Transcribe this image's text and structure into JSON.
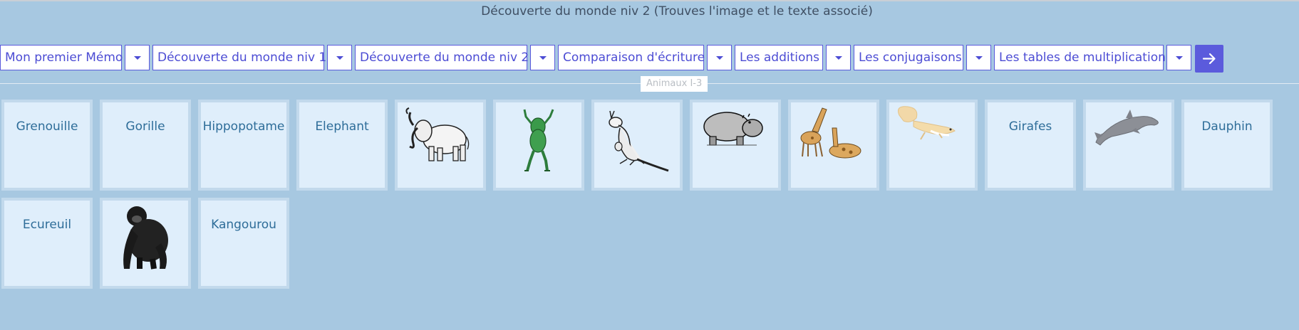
{
  "page": {
    "title": "Découverte du monde niv 2 (Trouves l'image et le texte associé)"
  },
  "toolbar": {
    "items": [
      {
        "label": "Mon premier Mémo"
      },
      {
        "label": "Découverte du monde niv 1"
      },
      {
        "label": "Découverte du monde niv 2"
      },
      {
        "label": "Comparaison d'écriture"
      },
      {
        "label": "Les additions"
      },
      {
        "label": "Les conjugaisons"
      },
      {
        "label": "Les tables de multiplication"
      }
    ],
    "next_icon": "arrow-right-icon",
    "accent_color": "#5b5bdc"
  },
  "section": {
    "label": "Animaux I-3"
  },
  "cards": {
    "grenouille": "Grenouille",
    "gorille": "Gorille",
    "hippopotame": "Hippopotame",
    "elephant": "Elephant",
    "girafes": "Girafes",
    "dauphin": "Dauphin",
    "ecureuil": "Ecureuil",
    "kangourou": "Kangourou",
    "images": [
      "elephant-image",
      "frog-image",
      "kangaroo-image",
      "hippo-image",
      "giraffes-image",
      "squirrel-image",
      "dolphin-image",
      "gorilla-image"
    ]
  }
}
